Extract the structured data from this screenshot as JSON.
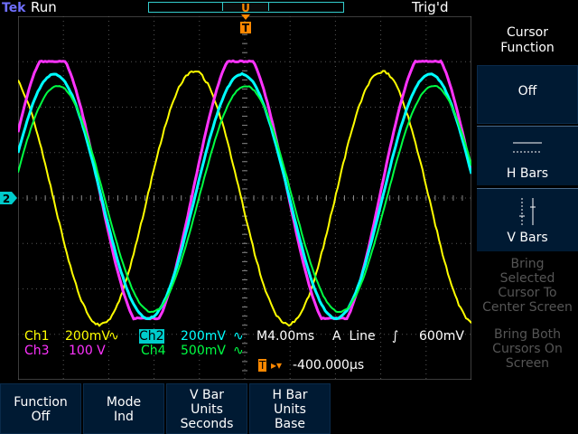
{
  "status": {
    "brand": "Tek",
    "run_state": "Run",
    "trigger_state": "Trig'd",
    "trigger_marker": "T"
  },
  "side_menu": {
    "title_line1": "Cursor",
    "title_line2": "Function",
    "options": [
      {
        "label": "Off",
        "selected": true
      },
      {
        "label": "H Bars"
      },
      {
        "label": "V Bars"
      }
    ],
    "disabled": [
      {
        "lines": [
          "Bring",
          "Selected",
          "Cursor To",
          "Center Screen"
        ]
      },
      {
        "lines": [
          "Bring Both",
          "Cursors On",
          "Screen"
        ]
      }
    ]
  },
  "bottom_menu": [
    {
      "line1": "Function",
      "line2": "Off"
    },
    {
      "line1": "Mode",
      "line2": "Ind"
    },
    {
      "line1": "V Bar",
      "line2": "Units",
      "line3": "Seconds"
    },
    {
      "line1": "H Bar",
      "line2": "Units",
      "line3": "Base"
    }
  ],
  "readout": {
    "ch1_label": "Ch1",
    "ch1_scale": "200mV",
    "ch2_label": "Ch2",
    "ch2_scale": "200mV",
    "ch3_label": "Ch3",
    "ch3_scale": "100 V",
    "ch4_label": "Ch4",
    "ch4_scale": "500mV",
    "timebase": "M4.00ms",
    "trigger_src": "A  Line",
    "trigger_level": "600mV",
    "position": "-400.000µs",
    "ground_marker": "2"
  },
  "colors": {
    "ch1": "#ffff00",
    "ch2": "#00ffff",
    "ch3": "#ff33ff",
    "ch4": "#00ff44",
    "trigger": "#ff8800",
    "menu_bg": "#001a33"
  },
  "icons": {
    "h_bars": "h-bars-icon",
    "v_bars": "v-bars-icon"
  }
}
